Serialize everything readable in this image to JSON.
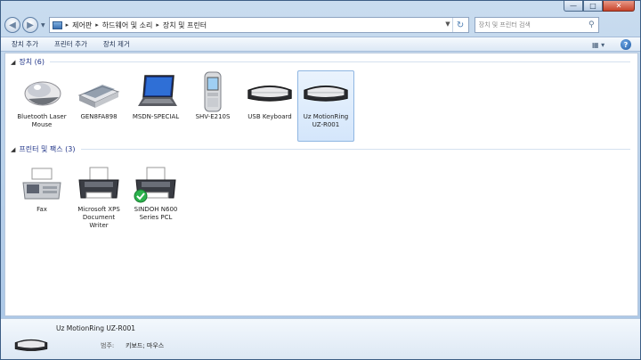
{
  "window": {
    "caption_buttons": [
      "minimize",
      "maximize",
      "close"
    ]
  },
  "address": {
    "icon": "control-panel-icon",
    "crumbs": [
      "제어판",
      "하드웨어 및 소리",
      "장치 및 프린터"
    ]
  },
  "search": {
    "placeholder": "장치 및 프린터 검색"
  },
  "toolbar": {
    "add_device": "장치 추가",
    "add_printer": "프린터 추가",
    "remove_device": "장치 제거"
  },
  "groups": {
    "devices": {
      "title": "장치 (6)"
    },
    "printers": {
      "title": "프린터 및 팩스 (3)"
    }
  },
  "devices": [
    {
      "label": "Bluetooth Laser Mouse",
      "icon": "mouse-icon"
    },
    {
      "label": "GEN8FA898",
      "icon": "scanner-icon"
    },
    {
      "label": "MSDN-SPECIAL",
      "icon": "laptop-icon"
    },
    {
      "label": "SHV-E210S",
      "icon": "phone-icon"
    },
    {
      "label": "USB Keyboard",
      "icon": "keyboard-icon"
    },
    {
      "label": "Uz MotionRing UZ-R001",
      "icon": "keyboard-icon",
      "selected": true
    }
  ],
  "printers": [
    {
      "label": "Fax",
      "icon": "fax-icon"
    },
    {
      "label": "Microsoft XPS Document Writer",
      "icon": "printer-icon"
    },
    {
      "label": "SINDOH N600 Series PCL",
      "icon": "printer-default-icon",
      "default": true
    }
  ],
  "details": {
    "title": "Uz MotionRing  UZ-R001",
    "category_label": "범주:",
    "category_value": "키보드; 마우스"
  }
}
